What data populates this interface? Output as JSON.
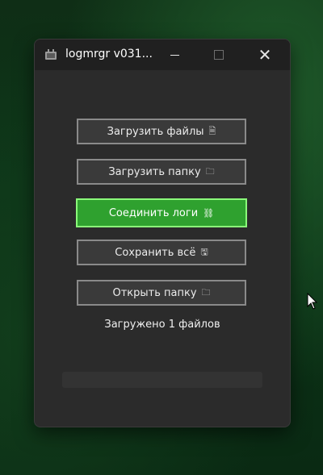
{
  "window": {
    "title": "logmrgr v031...",
    "icons": {
      "app": "app-icon",
      "minimize": "minimize-icon",
      "maximize": "maximize-icon",
      "close": "close-icon"
    },
    "close_glyph": "✕"
  },
  "buttons": [
    {
      "label": "Загрузить файлы",
      "icon": "🗎",
      "icon_name": "document-icon"
    },
    {
      "label": "Загрузить папку",
      "icon": "🗀",
      "icon_name": "folder-icon"
    },
    {
      "label": "Соединить логи",
      "icon": "⛓",
      "icon_name": "link-icon"
    },
    {
      "label": "Сохранить всё",
      "icon": "🖫",
      "icon_name": "save-icon"
    },
    {
      "label": "Открыть папку",
      "icon": "🗀",
      "icon_name": "folder-icon"
    }
  ],
  "status": "Загружено 1 файлов",
  "progress": {
    "value": 0
  },
  "colors": {
    "accent": "#2fa12f",
    "accent_border": "#8bff7a",
    "window_bg": "#2b2b2b",
    "titlebar_bg": "#202020"
  }
}
